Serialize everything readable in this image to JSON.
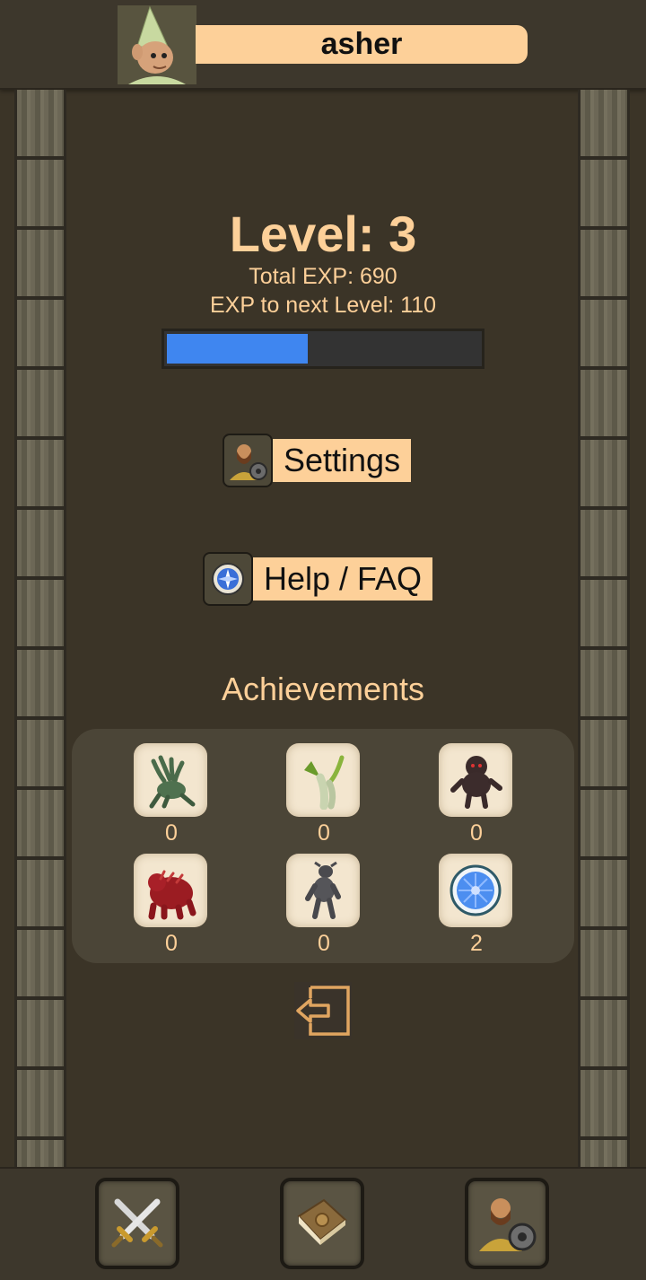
{
  "header": {
    "username": "asher",
    "avatar_icon": "gnome-avatar-icon"
  },
  "level": {
    "title": "Level: 3",
    "total_exp": "Total EXP: 690",
    "exp_to_next": "EXP to next Level: 110",
    "progress_fraction": 0.45,
    "progress_color": "#3f86f0"
  },
  "menu": {
    "settings_label": "Settings",
    "settings_icon": "settings-icon",
    "help_label": "Help / FAQ",
    "help_icon": "compass-icon"
  },
  "achievements": {
    "title": "Achievements",
    "items": [
      {
        "icon": "hydra-icon",
        "count": "0"
      },
      {
        "icon": "vorkath-dragon-icon",
        "count": "0"
      },
      {
        "icon": "demon-icon",
        "count": "0"
      },
      {
        "icon": "red-beast-icon",
        "count": "0"
      },
      {
        "icon": "gargoyle-icon",
        "count": "0"
      },
      {
        "icon": "blue-rune-icon",
        "count": "2"
      }
    ]
  },
  "logout_icon": "logout-icon",
  "bottom_nav": [
    {
      "icon": "crossed-swords-icon"
    },
    {
      "icon": "book-icon"
    },
    {
      "icon": "profile-settings-icon"
    }
  ],
  "colors": {
    "accent": "#fdd099",
    "background": "#3b3427",
    "panel": "#4b4537"
  }
}
